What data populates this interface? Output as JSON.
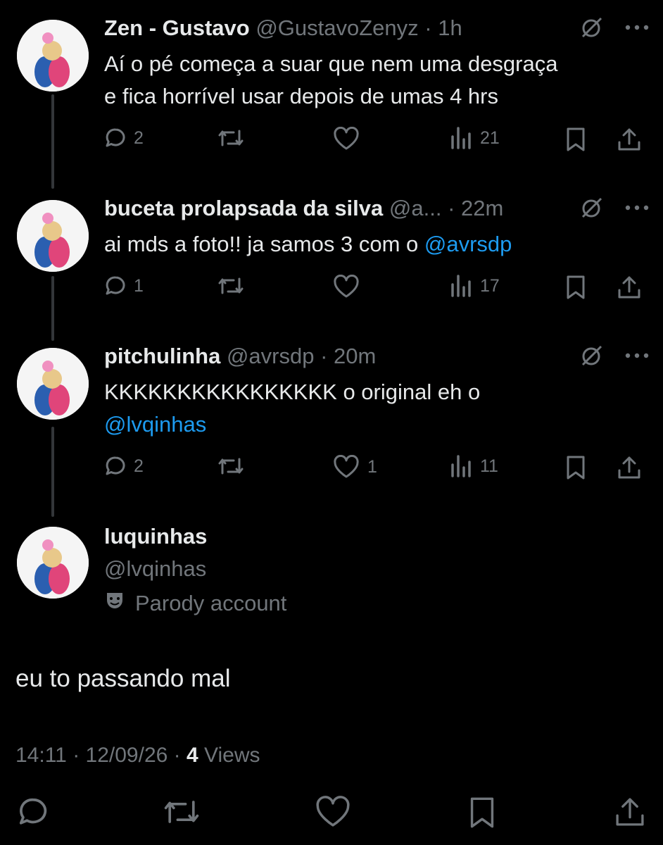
{
  "colors": {
    "background": "#000000",
    "text": "#e7e9ea",
    "muted": "#71767b",
    "link": "#1d9bf0",
    "line": "#333639"
  },
  "replies": [
    {
      "name": "Zen - Gustavo",
      "handle": "@GustavoZenyz",
      "dot": "·",
      "time": "1h",
      "text_lines": [
        "Aí o pé começa a suar que nem uma desgraça",
        "e fica horrível usar depois de umas 4 hrs"
      ],
      "stats": {
        "replies": "2",
        "reposts": "",
        "likes": "",
        "views": "21"
      }
    },
    {
      "name": "buceta prolapsada da silva",
      "handle": "@a...",
      "dot": "·",
      "time": "22m",
      "text_pre": "ai mds a foto!! ja samos 3 com o ",
      "mention": "@avrsdp",
      "stats": {
        "replies": "1",
        "reposts": "",
        "likes": "",
        "views": "17"
      }
    },
    {
      "name": "pitchulinha",
      "handle": "@avrsdp",
      "dot": "·",
      "time": "20m",
      "text_pre": "KKKKKKKKKKKKKKKK o original eh o",
      "mention": "@lvqinhas",
      "stats": {
        "replies": "2",
        "reposts": "",
        "likes": "1",
        "views": "11"
      }
    }
  ],
  "main_tweet": {
    "name": "luquinhas",
    "handle": "@lvqinhas",
    "label": "Parody account",
    "label_icon": "theater-mask-icon",
    "text": "eu to passando mal",
    "time": "14:11",
    "sep": "·",
    "date": "12/09/26",
    "views_count": "4",
    "views_label": "Views"
  },
  "icons": [
    "reply-icon",
    "repost-icon",
    "like-icon",
    "views-icon",
    "bookmark-icon",
    "share-icon",
    "grok-icon",
    "more-icon"
  ]
}
